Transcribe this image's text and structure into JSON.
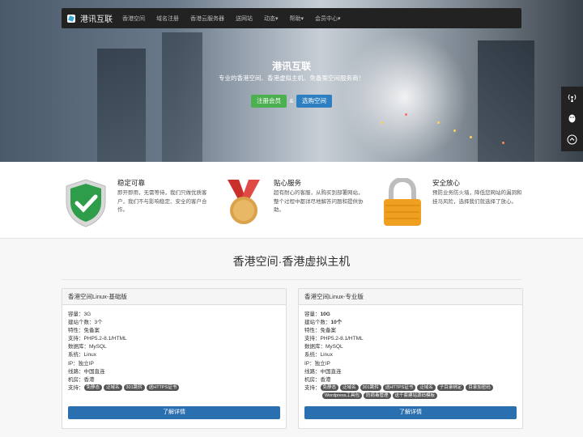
{
  "nav": {
    "brand": "港讯互联",
    "items": [
      "香港空间",
      "域名注册",
      "香港云服务器",
      "送网站",
      "动态",
      "帮助",
      "会员中心"
    ],
    "dropdown_marker": "▾"
  },
  "hero": {
    "title": "港讯互联",
    "subtitle": "专业的香港空间、香港虚拟主机、免备案空间服务商！",
    "register_label": "注册会员",
    "amp": "&",
    "host_label": "选购空间"
  },
  "sidebar": {
    "icons": [
      "broadcast-icon",
      "qq-icon",
      "back-to-top-icon"
    ]
  },
  "features": [
    {
      "title": "稳定可靠",
      "desc": "即开即用，无需等待，我们只做优质客户，我们不与影响稳定、安全的客户合作。",
      "icon": "shield-check-icon",
      "color": "#2e9d4a"
    },
    {
      "title": "贴心服务",
      "desc": "超有耐心的客服，从购买到部署网站，整个过程中都详尽地解答问题和提供协助。",
      "icon": "medal-icon",
      "color": "#c9302c"
    },
    {
      "title": "安全放心",
      "desc": "预防业务防火墙，降低您网站的漏洞和挂马风险，选择我们就选择了放心。",
      "icon": "padlock-icon",
      "color": "#f0a020"
    }
  ],
  "section_title": "香港空间·香港虚拟主机",
  "cards": [
    {
      "title": "香港空间Linux-基础版",
      "rows": [
        {
          "label": "容量：",
          "value": "3G",
          "bold": false
        },
        {
          "label": "建站个数：",
          "value": "3个",
          "bold": false
        },
        {
          "label": "特性：",
          "value": "免备案",
          "bold": false
        },
        {
          "label": "支持：",
          "value": "PHP5.2-8.1/HTML",
          "bold": false
        },
        {
          "label": "数据库：",
          "value": "MySQL",
          "bold": false
        },
        {
          "label": "系统：",
          "value": "Linux",
          "bold": false
        },
        {
          "label": "IP：",
          "value": "独立IP",
          "bold": false
        },
        {
          "label": "线路：",
          "value": "中国直连",
          "bold": false
        },
        {
          "label": "机房：",
          "value": "香港",
          "bold": false
        }
      ],
      "support_label": "支持：",
      "tags": [
        "免静态",
        "泛域名",
        "301跳转",
        "送HTTPS证书"
      ],
      "button": "了解详情"
    },
    {
      "title": "香港空间Linux-专业版",
      "rows": [
        {
          "label": "容量：",
          "value": "10G",
          "bold": true
        },
        {
          "label": "建站个数：",
          "value": "10个",
          "bold": true
        },
        {
          "label": "特性：",
          "value": "免备案",
          "bold": false
        },
        {
          "label": "支持：",
          "value": "PHP5.2-8.1/HTML",
          "bold": false
        },
        {
          "label": "数据库：",
          "value": "MySQL",
          "bold": false
        },
        {
          "label": "系统：",
          "value": "Linux",
          "bold": false
        },
        {
          "label": "IP：",
          "value": "独立IP",
          "bold": false
        },
        {
          "label": "线路：",
          "value": "中国直连",
          "bold": false
        },
        {
          "label": "机房：",
          "value": "香港",
          "bold": false
        }
      ],
      "support_label": "支持：",
      "tags": [
        "免静态",
        "泛域名",
        "301跳转",
        "送HTTPS证书",
        "泛域名",
        "子目录绑定",
        "目录加密码",
        "Wordpress工具包",
        "防病毒管理",
        "送千套建站源码模板"
      ],
      "button": "了解详情"
    }
  ]
}
